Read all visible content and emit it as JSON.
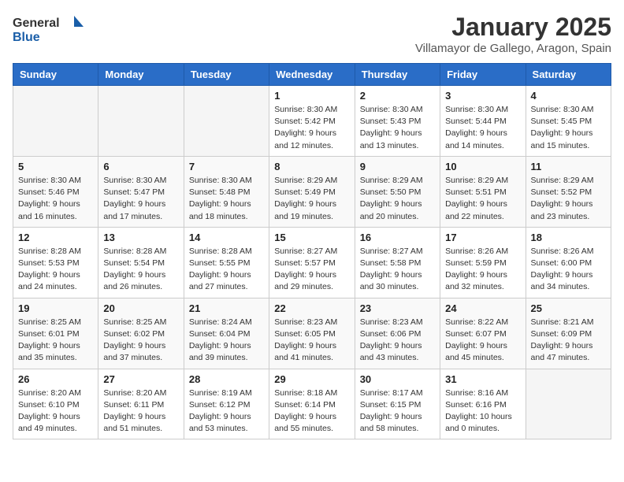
{
  "logo": {
    "general": "General",
    "blue": "Blue"
  },
  "header": {
    "month_year": "January 2025",
    "location": "Villamayor de Gallego, Aragon, Spain"
  },
  "weekdays": [
    "Sunday",
    "Monday",
    "Tuesday",
    "Wednesday",
    "Thursday",
    "Friday",
    "Saturday"
  ],
  "weeks": [
    [
      {
        "day": "",
        "info": ""
      },
      {
        "day": "",
        "info": ""
      },
      {
        "day": "",
        "info": ""
      },
      {
        "day": "1",
        "info": "Sunrise: 8:30 AM\nSunset: 5:42 PM\nDaylight: 9 hours\nand 12 minutes."
      },
      {
        "day": "2",
        "info": "Sunrise: 8:30 AM\nSunset: 5:43 PM\nDaylight: 9 hours\nand 13 minutes."
      },
      {
        "day": "3",
        "info": "Sunrise: 8:30 AM\nSunset: 5:44 PM\nDaylight: 9 hours\nand 14 minutes."
      },
      {
        "day": "4",
        "info": "Sunrise: 8:30 AM\nSunset: 5:45 PM\nDaylight: 9 hours\nand 15 minutes."
      }
    ],
    [
      {
        "day": "5",
        "info": "Sunrise: 8:30 AM\nSunset: 5:46 PM\nDaylight: 9 hours\nand 16 minutes."
      },
      {
        "day": "6",
        "info": "Sunrise: 8:30 AM\nSunset: 5:47 PM\nDaylight: 9 hours\nand 17 minutes."
      },
      {
        "day": "7",
        "info": "Sunrise: 8:30 AM\nSunset: 5:48 PM\nDaylight: 9 hours\nand 18 minutes."
      },
      {
        "day": "8",
        "info": "Sunrise: 8:29 AM\nSunset: 5:49 PM\nDaylight: 9 hours\nand 19 minutes."
      },
      {
        "day": "9",
        "info": "Sunrise: 8:29 AM\nSunset: 5:50 PM\nDaylight: 9 hours\nand 20 minutes."
      },
      {
        "day": "10",
        "info": "Sunrise: 8:29 AM\nSunset: 5:51 PM\nDaylight: 9 hours\nand 22 minutes."
      },
      {
        "day": "11",
        "info": "Sunrise: 8:29 AM\nSunset: 5:52 PM\nDaylight: 9 hours\nand 23 minutes."
      }
    ],
    [
      {
        "day": "12",
        "info": "Sunrise: 8:28 AM\nSunset: 5:53 PM\nDaylight: 9 hours\nand 24 minutes."
      },
      {
        "day": "13",
        "info": "Sunrise: 8:28 AM\nSunset: 5:54 PM\nDaylight: 9 hours\nand 26 minutes."
      },
      {
        "day": "14",
        "info": "Sunrise: 8:28 AM\nSunset: 5:55 PM\nDaylight: 9 hours\nand 27 minutes."
      },
      {
        "day": "15",
        "info": "Sunrise: 8:27 AM\nSunset: 5:57 PM\nDaylight: 9 hours\nand 29 minutes."
      },
      {
        "day": "16",
        "info": "Sunrise: 8:27 AM\nSunset: 5:58 PM\nDaylight: 9 hours\nand 30 minutes."
      },
      {
        "day": "17",
        "info": "Sunrise: 8:26 AM\nSunset: 5:59 PM\nDaylight: 9 hours\nand 32 minutes."
      },
      {
        "day": "18",
        "info": "Sunrise: 8:26 AM\nSunset: 6:00 PM\nDaylight: 9 hours\nand 34 minutes."
      }
    ],
    [
      {
        "day": "19",
        "info": "Sunrise: 8:25 AM\nSunset: 6:01 PM\nDaylight: 9 hours\nand 35 minutes."
      },
      {
        "day": "20",
        "info": "Sunrise: 8:25 AM\nSunset: 6:02 PM\nDaylight: 9 hours\nand 37 minutes."
      },
      {
        "day": "21",
        "info": "Sunrise: 8:24 AM\nSunset: 6:04 PM\nDaylight: 9 hours\nand 39 minutes."
      },
      {
        "day": "22",
        "info": "Sunrise: 8:23 AM\nSunset: 6:05 PM\nDaylight: 9 hours\nand 41 minutes."
      },
      {
        "day": "23",
        "info": "Sunrise: 8:23 AM\nSunset: 6:06 PM\nDaylight: 9 hours\nand 43 minutes."
      },
      {
        "day": "24",
        "info": "Sunrise: 8:22 AM\nSunset: 6:07 PM\nDaylight: 9 hours\nand 45 minutes."
      },
      {
        "day": "25",
        "info": "Sunrise: 8:21 AM\nSunset: 6:09 PM\nDaylight: 9 hours\nand 47 minutes."
      }
    ],
    [
      {
        "day": "26",
        "info": "Sunrise: 8:20 AM\nSunset: 6:10 PM\nDaylight: 9 hours\nand 49 minutes."
      },
      {
        "day": "27",
        "info": "Sunrise: 8:20 AM\nSunset: 6:11 PM\nDaylight: 9 hours\nand 51 minutes."
      },
      {
        "day": "28",
        "info": "Sunrise: 8:19 AM\nSunset: 6:12 PM\nDaylight: 9 hours\nand 53 minutes."
      },
      {
        "day": "29",
        "info": "Sunrise: 8:18 AM\nSunset: 6:14 PM\nDaylight: 9 hours\nand 55 minutes."
      },
      {
        "day": "30",
        "info": "Sunrise: 8:17 AM\nSunset: 6:15 PM\nDaylight: 9 hours\nand 58 minutes."
      },
      {
        "day": "31",
        "info": "Sunrise: 8:16 AM\nSunset: 6:16 PM\nDaylight: 10 hours\nand 0 minutes."
      },
      {
        "day": "",
        "info": ""
      }
    ]
  ]
}
